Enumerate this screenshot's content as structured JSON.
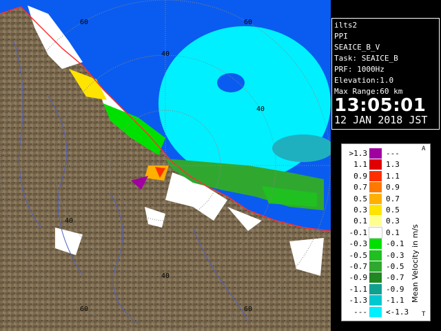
{
  "header": {
    "radar_name": "ilts2",
    "product": "PPI",
    "scan_name": "SEAICE_B_V",
    "task_line": "Task: SEAICE_B",
    "prf_line": "PRF: 1000Hz",
    "elevation_line": "Elevation:1.0",
    "range_line": "Max Range:60 km",
    "time": "13:05:01",
    "date": "12 JAN 2018 JST"
  },
  "rings": {
    "labels": [
      "60",
      "60",
      "40",
      "40",
      "40",
      "40",
      "60",
      "60"
    ]
  },
  "legend": {
    "title": "Mean Velocity in m/s",
    "top_mark": "A",
    "bottom_mark": "T",
    "rows": [
      {
        "left": ">1.3",
        "right": "---",
        "color": "#a000a0"
      },
      {
        "left": "1.1",
        "right": "1.3",
        "color": "#e00000"
      },
      {
        "left": "0.9",
        "right": "1.1",
        "color": "#ff3000"
      },
      {
        "left": "0.7",
        "right": "0.9",
        "color": "#ff7800"
      },
      {
        "left": "0.5",
        "right": "0.7",
        "color": "#ffb000"
      },
      {
        "left": "0.3",
        "right": "0.5",
        "color": "#ffe400"
      },
      {
        "left": "0.1",
        "right": "0.3",
        "color": "#ffff90"
      },
      {
        "left": "-0.1",
        "right": "0.1",
        "color": "#ffffff"
      },
      {
        "left": "-0.3",
        "right": "-0.1",
        "color": "#00e000"
      },
      {
        "left": "-0.5",
        "right": "-0.3",
        "color": "#20c020"
      },
      {
        "left": "-0.7",
        "right": "-0.5",
        "color": "#30a830"
      },
      {
        "left": "-0.9",
        "right": "-0.7",
        "color": "#208820"
      },
      {
        "left": "-1.1",
        "right": "-0.9",
        "color": "#10a090"
      },
      {
        "left": "-1.3",
        "right": "-1.1",
        "color": "#00c8d0"
      },
      {
        "left": "---",
        "right": "<-1.3",
        "color": "#00f0ff"
      }
    ]
  },
  "colors": {
    "sea": "#0a5cf0",
    "land": "#7b6a4f",
    "coast": "#ff3030",
    "rings": "#888888"
  }
}
